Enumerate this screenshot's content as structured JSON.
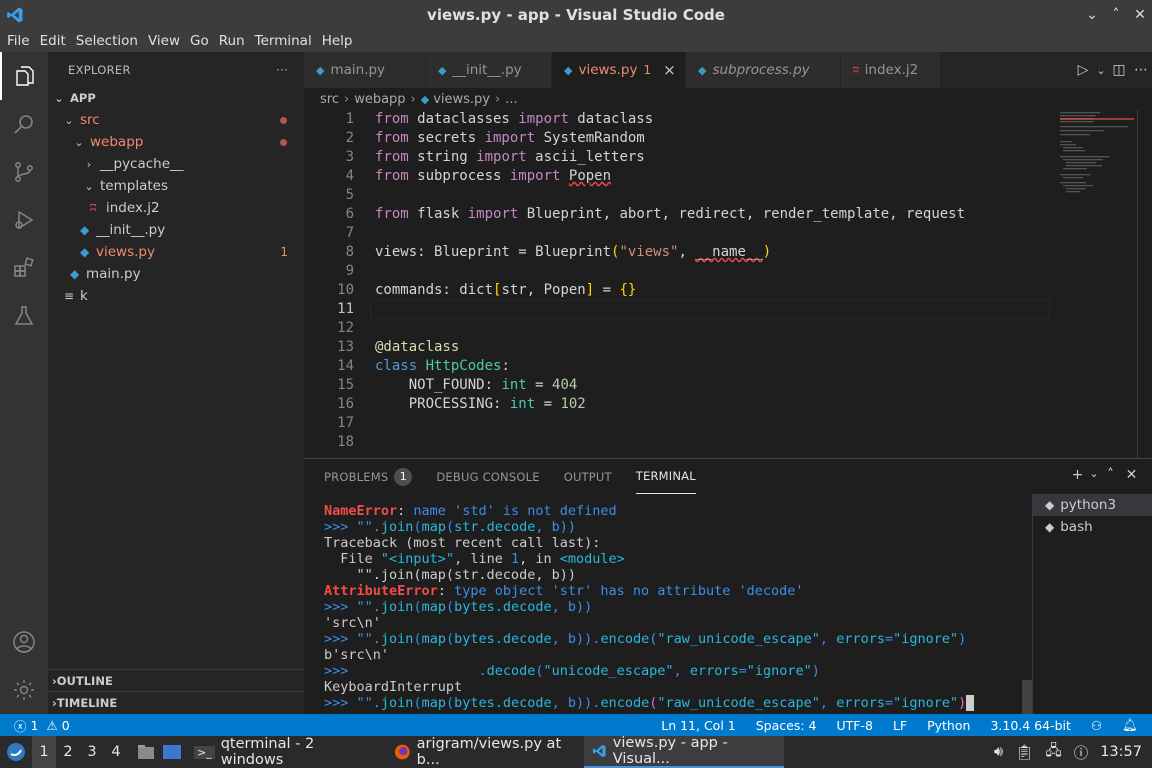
{
  "window": {
    "title": "views.py - app - Visual Studio Code"
  },
  "menu": [
    "File",
    "Edit",
    "Selection",
    "View",
    "Go",
    "Run",
    "Terminal",
    "Help"
  ],
  "sidebar": {
    "header": "EXPLORER",
    "more": "···",
    "root": "APP",
    "tree": [
      {
        "label": "src",
        "depth": 1,
        "kind": "folder-open",
        "color": "#f48771",
        "dot": true
      },
      {
        "label": "webapp",
        "depth": 2,
        "kind": "folder-open",
        "color": "#f48771",
        "dot": true
      },
      {
        "label": "__pycache__",
        "depth": 3,
        "kind": "folder-closed",
        "color": "#cccccc"
      },
      {
        "label": "templates",
        "depth": 3,
        "kind": "folder-open",
        "color": "#cccccc"
      },
      {
        "label": "index.j2",
        "depth": 4,
        "kind": "jinja-file",
        "color": "#cccccc"
      },
      {
        "label": "__init__.py",
        "depth": 3,
        "kind": "python-file",
        "color": "#cccccc"
      },
      {
        "label": "views.py",
        "depth": 3,
        "kind": "python-file",
        "color": "#f48771",
        "badge": "1"
      },
      {
        "label": "main.py",
        "depth": 2,
        "kind": "python-file",
        "color": "#cccccc"
      },
      {
        "label": "k",
        "depth": 1,
        "kind": "text-file",
        "color": "#cccccc"
      }
    ],
    "outline": "OUTLINE",
    "timeline": "TIMELINE"
  },
  "tabs": [
    {
      "label": "main.py",
      "icon": "python-file-icon",
      "state": "normal"
    },
    {
      "label": "__init__.py",
      "icon": "python-file-icon",
      "state": "normal"
    },
    {
      "label": "views.py",
      "icon": "python-file-icon",
      "state": "active",
      "badge": "1",
      "close": "×"
    },
    {
      "label": "subprocess.py",
      "icon": "python-file-icon",
      "state": "preview"
    },
    {
      "label": "index.j2",
      "icon": "jinja-file-icon",
      "state": "normal"
    }
  ],
  "breadcrumb": {
    "parts": [
      "src",
      "webapp",
      "views.py",
      "..."
    ]
  },
  "editor": {
    "line_numbers": [
      "1",
      "2",
      "3",
      "4",
      "5",
      "6",
      "7",
      "8",
      "9",
      "10",
      "11",
      "12",
      "13",
      "14",
      "15",
      "16",
      "17",
      "18"
    ],
    "current_line": "11"
  },
  "panel": {
    "tabs": [
      {
        "label": "PROBLEMS",
        "badge": "1"
      },
      {
        "label": "DEBUG CONSOLE"
      },
      {
        "label": "OUTPUT"
      },
      {
        "label": "TERMINAL",
        "active": true
      }
    ],
    "terminals": [
      "python3",
      "bash"
    ]
  },
  "statusbar": {
    "errors": "1",
    "warnings": "0",
    "position": "Ln 11, Col 1",
    "spaces": "Spaces: 4",
    "encoding": "UTF-8",
    "eol": "LF",
    "language": "Python",
    "interpreter": "3.10.4 64-bit"
  },
  "taskbar": {
    "workspaces": [
      "1",
      "2",
      "3",
      "4"
    ],
    "tasks": [
      {
        "label": "qterminal - 2 windows",
        "icon": "terminal-icon"
      },
      {
        "label": "arigram/views.py at b...",
        "icon": "firefox-icon"
      },
      {
        "label": "views.py - app - Visual...",
        "icon": "vscode-icon",
        "active": true
      }
    ],
    "clock": "13:57"
  }
}
